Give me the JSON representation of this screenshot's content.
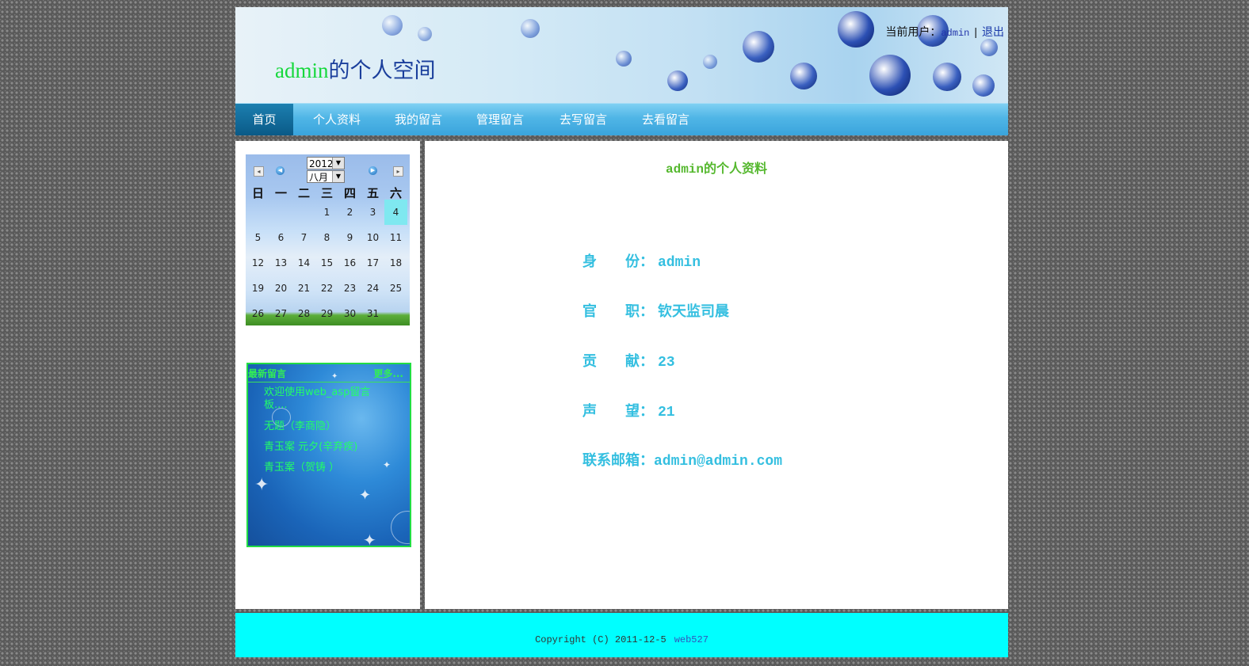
{
  "header": {
    "title_user": "admin",
    "title_rest": "的个人空间",
    "current_user_label": "当前用户：",
    "current_user": "admin",
    "separator": "|",
    "logout": "退出"
  },
  "nav": {
    "items": [
      {
        "label": "首页",
        "active": true
      },
      {
        "label": "个人资料"
      },
      {
        "label": "我的留言"
      },
      {
        "label": "管理留言"
      },
      {
        "label": "去写留言"
      },
      {
        "label": "去看留言"
      }
    ]
  },
  "calendar": {
    "year": "2012",
    "month": "八月",
    "weekdays": [
      "日",
      "一",
      "二",
      "三",
      "四",
      "五",
      "六"
    ],
    "first_weekday": 3,
    "days_in_month": 31,
    "today": 4
  },
  "messages": {
    "title": "最新留言",
    "more": "更多...",
    "items": [
      "欢迎使用web_asp留言板....",
      "无题（李商隐）",
      "青玉案 元夕(辛弃疾)",
      "青玉案（贺铸 ）"
    ]
  },
  "profile": {
    "title": "admin的个人资料",
    "rows": [
      {
        "label": "身　　份：",
        "value": "admin"
      },
      {
        "label": "官　　职：",
        "value": "钦天监司晨"
      },
      {
        "label": "贡　　献：",
        "value": "23"
      },
      {
        "label": "声　　望：",
        "value": "21"
      },
      {
        "label": "联系邮箱：",
        "value": "admin@admin.com"
      }
    ]
  },
  "footer": {
    "copyright": "Copyright (C) 2011-12-5",
    "site": "web527"
  },
  "colors": {
    "title_user": "#16d83c",
    "title_rest": "#1b3f9c",
    "profile_text": "#34bfe0",
    "profile_title": "#55b82e",
    "footer_bg": "#00ffff",
    "message_text": "#22ff66"
  }
}
